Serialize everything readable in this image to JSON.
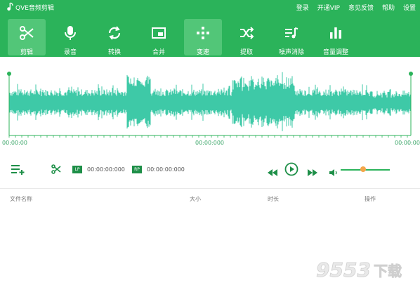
{
  "app": {
    "title": "QVE音频剪辑"
  },
  "menu": [
    "登录",
    "开通VIP",
    "意见反馈",
    "帮助",
    "设置"
  ],
  "toolbar": {
    "items": [
      {
        "label": "剪辑",
        "icon": "scissors-icon",
        "active": true
      },
      {
        "label": "录音",
        "icon": "microphone-icon",
        "active": false
      },
      {
        "label": "转换",
        "icon": "convert-icon",
        "active": false
      },
      {
        "label": "合并",
        "icon": "merge-icon",
        "active": false
      },
      {
        "label": "变速",
        "icon": "speed-icon",
        "active": true
      },
      {
        "label": "提取",
        "icon": "shuffle-icon",
        "active": false
      },
      {
        "label": "噪声消除",
        "icon": "noise-removal-icon",
        "active": false
      },
      {
        "label": "音量调整",
        "icon": "volume-bars-icon",
        "active": false
      }
    ]
  },
  "timeline": {
    "start": "00:00:00",
    "middle": "00:00:000",
    "end": "00:00:00"
  },
  "controls": {
    "lp_badge": "LP",
    "lp_time": "00:00:00:000",
    "rp_badge": "RP",
    "rp_time": "00:00:00:000",
    "volume": 0.45
  },
  "table": {
    "headers": {
      "name": "文件名称",
      "size": "大小",
      "duration": "时长",
      "action": "操作"
    }
  },
  "watermark": {
    "text": "9553下载"
  },
  "colors": {
    "brand": "#2bb35a",
    "wave": "#3ec9a7",
    "thumb": "#f4a64b"
  }
}
